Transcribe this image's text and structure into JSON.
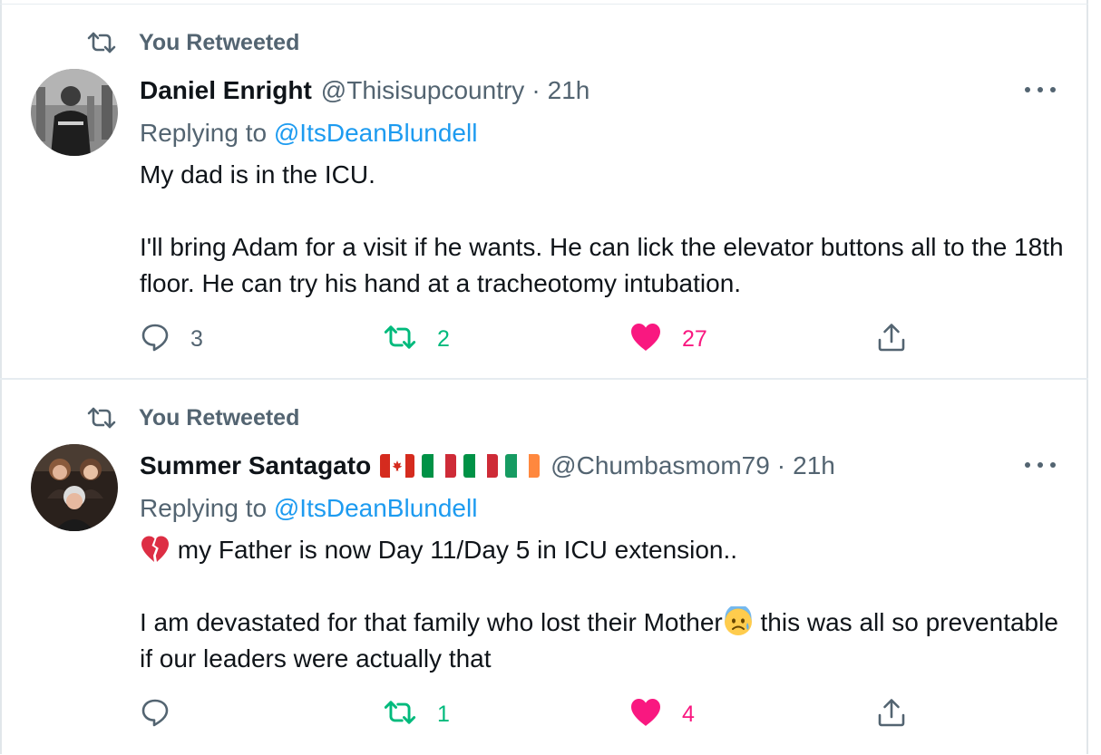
{
  "tweets": [
    {
      "retweet_label": "You Retweeted",
      "author_name": "Daniel Enright",
      "author_handle": "@Thisisupcountry",
      "separator": "·",
      "time": "21h",
      "replying_prefix": "Replying to",
      "replying_to": "@ItsDeanBlundell",
      "body_lines": [
        "My dad is in the ICU.",
        "I'll bring Adam for a visit if he wants. He can lick the elevator buttons all to the 18th floor. He can try his hand at a tracheotomy intubation."
      ],
      "reply_count": "3",
      "retweet_count": "2",
      "like_count": "27",
      "liked": true,
      "retweeted": true
    },
    {
      "retweet_label": "You Retweeted",
      "author_name": "Summer Santagato",
      "author_flags": [
        "canada-flag",
        "italy-flag",
        "italy-flag",
        "ireland-flag"
      ],
      "author_handle": "@Chumbasmom79",
      "separator": "·",
      "time": "21h",
      "replying_prefix": "Replying to",
      "replying_to": "@ItsDeanBlundell",
      "body_line1": "my Father is now Day 11/Day 5 in ICU extension..",
      "body_line1_emoji": "broken-heart-emoji",
      "body_line2_part1": "I am devastated for that family who lost their Mother",
      "body_line2_emoji": "anxious-face-with-sweat-emoji",
      "body_line2_part2": " this was all so preventable if our leaders were actually that",
      "reply_count": "",
      "retweet_count": "1",
      "like_count": "4",
      "liked": true,
      "retweeted": true
    }
  ],
  "colors": {
    "secondary_text": "#536471",
    "link": "#1d9bf0",
    "retweet_green": "#00ba7c",
    "like_pink": "#f91880",
    "divider": "#e6ecf0"
  }
}
